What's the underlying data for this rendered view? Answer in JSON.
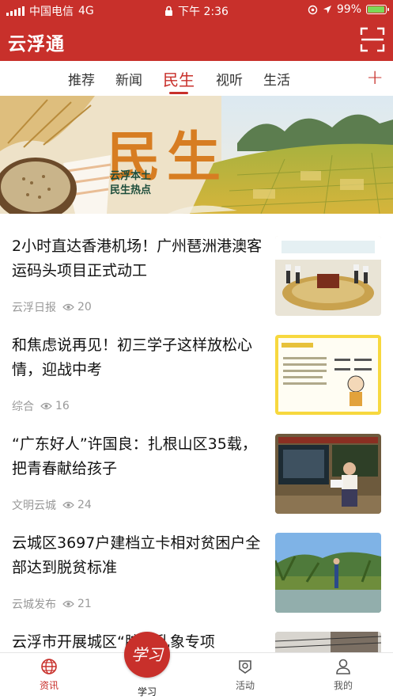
{
  "status_bar": {
    "carrier": "中国电信",
    "network": "4G",
    "time": "下午 2:36",
    "battery": "99%",
    "battery_level": 0.99
  },
  "app_title": "云浮通",
  "tabs": [
    {
      "label": "推荐"
    },
    {
      "label": "新闻"
    },
    {
      "label": "民生",
      "active": true
    },
    {
      "label": "视听"
    },
    {
      "label": "生活"
    }
  ],
  "banner": {
    "main_text": "民生",
    "sub_line1": "云浮本土",
    "sub_line2": "民生热点"
  },
  "news": [
    {
      "title": "2小时直达香港机场！广州琶洲港澳客运码头项目正式动工",
      "source": "云浮日报",
      "views": "20"
    },
    {
      "title": "和焦虑说再见！初三学子这样放松心情，迎战中考",
      "source": "综合",
      "views": "16"
    },
    {
      "title": "“广东好人”许国良：扎根山区35载，把青春献给孩子",
      "source": "文明云城",
      "views": "24"
    },
    {
      "title": "云城区3697户建档立卡相对贫困户全部达到脱贫标准",
      "source": "云城发布",
      "views": "21"
    },
    {
      "title": "云浮市开展城区“脏放乱象专项",
      "source": "",
      "views": ""
    }
  ],
  "bottom_nav": {
    "items": [
      {
        "label": "资讯",
        "icon": "globe-icon",
        "active": true
      },
      {
        "label": "活动",
        "icon": "activity-icon"
      },
      {
        "label": "我的",
        "icon": "user-icon"
      }
    ],
    "center": {
      "label": "学习",
      "badge_text": "学习"
    }
  },
  "colors": {
    "brand": "#c8302b",
    "muted": "#999999"
  }
}
